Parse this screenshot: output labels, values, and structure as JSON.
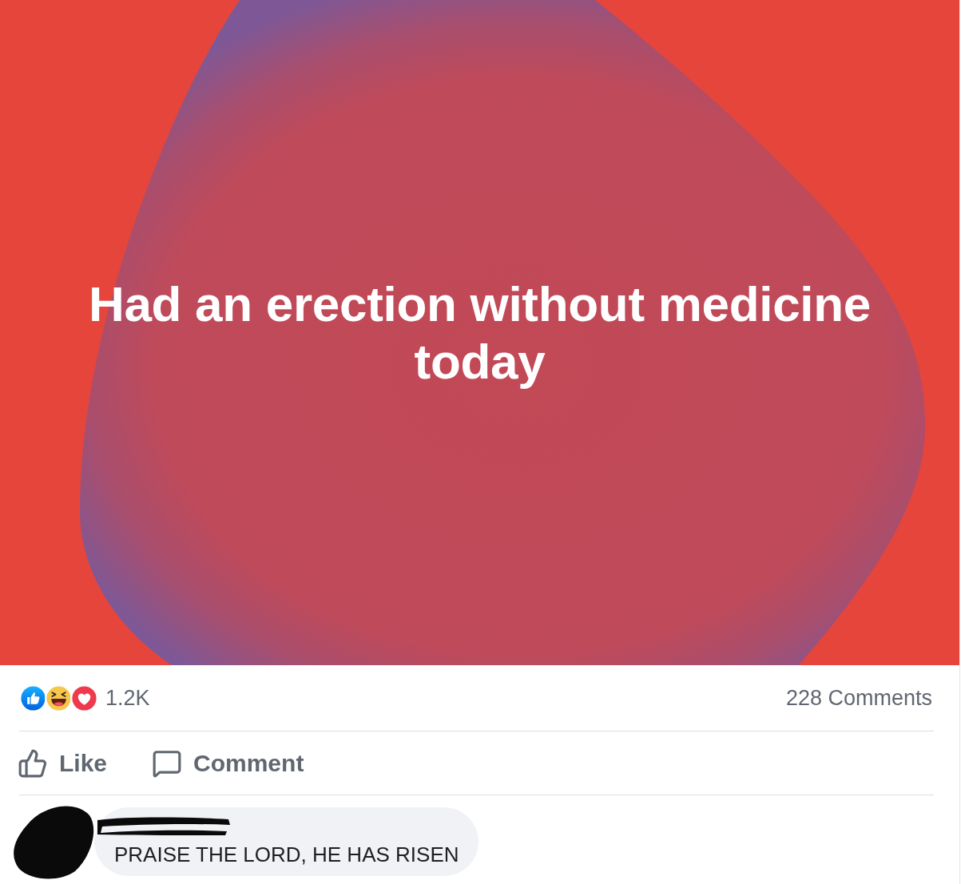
{
  "post": {
    "text": "Had an erection without medicine today"
  },
  "stats": {
    "reactions": [
      {
        "kind": "like"
      },
      {
        "kind": "haha"
      },
      {
        "kind": "love"
      }
    ],
    "reaction_count": "1.2K",
    "comment_count": "228 Comments"
  },
  "actions": [
    {
      "kind": "like",
      "label": "Like"
    },
    {
      "kind": "comment",
      "label": "Comment"
    }
  ],
  "comments": [
    {
      "author_redacted": true,
      "text": "PRAISE THE LORD, HE HAS RISEN"
    }
  ]
}
